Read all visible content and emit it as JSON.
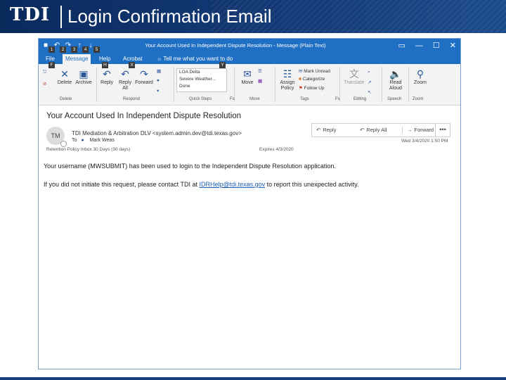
{
  "slide": {
    "logo": "TDI",
    "title": "Login Confirmation Email"
  },
  "window": {
    "title": "Your Account Used In Independent Dispute Resolution  -  Message (Plain Text)",
    "controls": [
      "▭",
      "—",
      "☐",
      "✕"
    ],
    "tabs": [
      "File",
      "Message",
      "Help",
      "Acrobat"
    ],
    "active_tab": "Message",
    "tell_me": "Tell me what you want to do",
    "keytips": [
      "1",
      "2",
      "3",
      "4",
      "5",
      "F",
      "H",
      "X",
      "Y"
    ]
  },
  "ribbon": {
    "delete": "Delete",
    "archive": "Archive",
    "reply": "Reply",
    "reply_all": "Reply All",
    "forward": "Forward",
    "quick_steps": [
      "LOA Delta",
      "Severe Weather...",
      "Done"
    ],
    "move": "Move",
    "mark_unread": "Mark Unread",
    "categorize": "Categorize",
    "follow_up": "Follow Up",
    "assign_policy": "Assign Policy",
    "translate": "Translate",
    "read_aloud": "Read Aloud",
    "zoom": "Zoom",
    "groups": [
      "Delete",
      "Respond",
      "Quick Steps",
      "Fs",
      "Move",
      "Tags",
      "Fs",
      "Editing",
      "Speech",
      "Zoom"
    ]
  },
  "message": {
    "subject": "Your Account Used In Independent Dispute Resolution",
    "avatar_initials": "TM",
    "sender": "TDI Mediation & Arbitration DLV <system.admin.dev@tdi.texas.gov>",
    "to_label": "To",
    "recipient": "Mark Weas",
    "retention": "Retention Policy   Inbox 30 Days (30 days)",
    "expires": "Expires   4/3/2020",
    "timestamp": "Wed 3/4/2020 1:50 PM",
    "actions": {
      "reply": "Reply",
      "reply_all": "Reply All",
      "forward": "Forward",
      "more": "•••"
    },
    "body_line1": "Your username (MWSUBMIT) has been used to login to the Independent Dispute Resolution application.",
    "body_line2_pre": "If you did not initiate this request, please contact TDI at ",
    "body_line2_link": "IDRHelp@tdi.texas.gov",
    "body_line2_post": " to report this unexpected activity."
  },
  "colors": {
    "title_bar": "#1f6fc5",
    "slide_header": "#0a2a5c",
    "link": "#1a5fb4"
  }
}
